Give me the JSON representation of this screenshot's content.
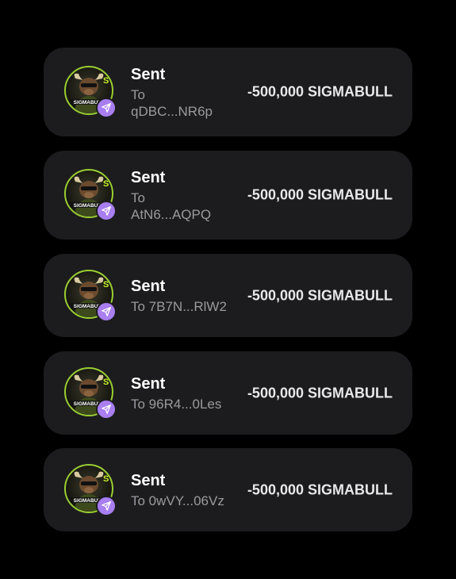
{
  "colors": {
    "background": "#000000",
    "card": "#1c1c1e",
    "badge": "#a87ef0",
    "secondary_text": "#9a9a9f",
    "avatar_ring": "#9acd32"
  },
  "transactions": [
    {
      "avatar_icon": "sigmabull-token-icon",
      "badge_icon": "send-icon",
      "title": "Sent",
      "recipient_line1": "To",
      "recipient_line2": "qDBC...NR6p",
      "amount": "-500,000 SIGMABULL"
    },
    {
      "avatar_icon": "sigmabull-token-icon",
      "badge_icon": "send-icon",
      "title": "Sent",
      "recipient_line1": "To",
      "recipient_line2": "AtN6...AQPQ",
      "amount": "-500,000 SIGMABULL"
    },
    {
      "avatar_icon": "sigmabull-token-icon",
      "badge_icon": "send-icon",
      "title": "Sent",
      "recipient_line1": "To 7B7N...RlW2",
      "recipient_line2": "",
      "amount": "-500,000 SIGMABULL"
    },
    {
      "avatar_icon": "sigmabull-token-icon",
      "badge_icon": "send-icon",
      "title": "Sent",
      "recipient_line1": "To 96R4...0Les",
      "recipient_line2": "",
      "amount": "-500,000 SIGMABULL"
    },
    {
      "avatar_icon": "sigmabull-token-icon",
      "badge_icon": "send-icon",
      "title": "Sent",
      "recipient_line1": "To 0wVY...06Vz",
      "recipient_line2": "",
      "amount": "-500,000 SIGMABULL"
    }
  ]
}
